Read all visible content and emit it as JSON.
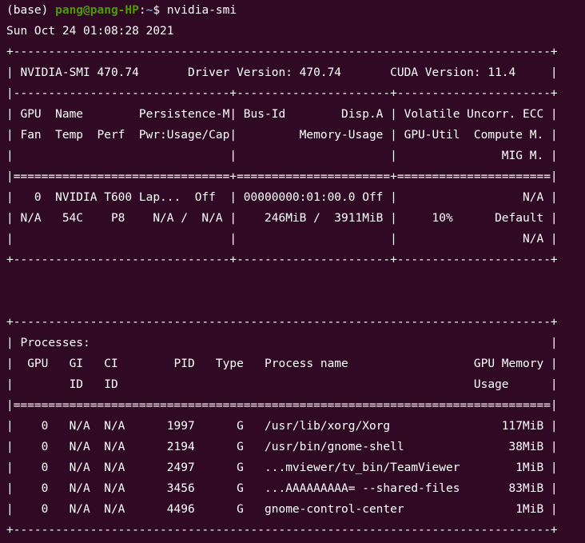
{
  "colors": {
    "background": "#300a24",
    "text": "#ffffff",
    "prompt_user": "#4e9a06",
    "prompt_path": "#729fcf"
  },
  "prompt": {
    "env": "(base) ",
    "user_host": "pang@pang-HP",
    "sep": ":",
    "path": "~",
    "symbol": "$ "
  },
  "command": "nvidia-smi",
  "output_lines": [
    "Sun Oct 24 01:08:28 2021",
    "+-----------------------------------------------------------------------------+",
    "| NVIDIA-SMI 470.74       Driver Version: 470.74       CUDA Version: 11.4     |",
    "|-------------------------------+----------------------+----------------------+",
    "| GPU  Name        Persistence-M| Bus-Id        Disp.A | Volatile Uncorr. ECC |",
    "| Fan  Temp  Perf  Pwr:Usage/Cap|         Memory-Usage | GPU-Util  Compute M. |",
    "|                               |                      |               MIG M. |",
    "|===============================+======================+======================|",
    "|   0  NVIDIA T600 Lap...  Off  | 00000000:01:00.0 Off |                  N/A |",
    "| N/A   54C    P8    N/A /  N/A |    246MiB /  3911MiB |     10%      Default |",
    "|                               |                      |                  N/A |",
    "+-------------------------------+----------------------+----------------------+",
    "",
    "",
    "+-----------------------------------------------------------------------------+",
    "| Processes:                                                                  |",
    "|  GPU   GI   CI        PID   Type   Process name                  GPU Memory |",
    "|        ID   ID                                                   Usage      |",
    "|=============================================================================|",
    "|    0   N/A  N/A      1997      G   /usr/lib/xorg/Xorg                117MiB |",
    "|    0   N/A  N/A      2194      G   /usr/bin/gnome-shell               38MiB |",
    "|    0   N/A  N/A      2497      G   ...mviewer/tv_bin/TeamViewer        1MiB |",
    "|    0   N/A  N/A      3456      G   ...AAAAAAAAA= --shared-files       83MiB |",
    "|    0   N/A  N/A      4496      G   gnome-control-center                1MiB |",
    "+-----------------------------------------------------------------------------+"
  ]
}
